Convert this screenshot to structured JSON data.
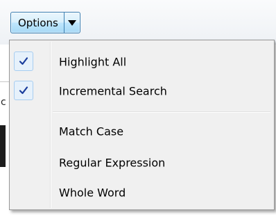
{
  "options_button": {
    "label": "Options"
  },
  "menu": {
    "checked_items": [
      {
        "label": "Highlight All",
        "checked": true,
        "icon": "checkmark-icon"
      },
      {
        "label": "Incremental Search",
        "checked": true,
        "icon": "checkmark-icon"
      }
    ],
    "unchecked_items": [
      {
        "label": "Match Case",
        "checked": false
      },
      {
        "label": "Regular Expression",
        "checked": false
      },
      {
        "label": "Whole Word",
        "checked": false
      }
    ]
  },
  "background": {
    "partial_char": "c"
  },
  "colors": {
    "button_border": "#3c7fb1",
    "check_color": "#1a3d9c",
    "menu_background": "#f0f0f0"
  }
}
